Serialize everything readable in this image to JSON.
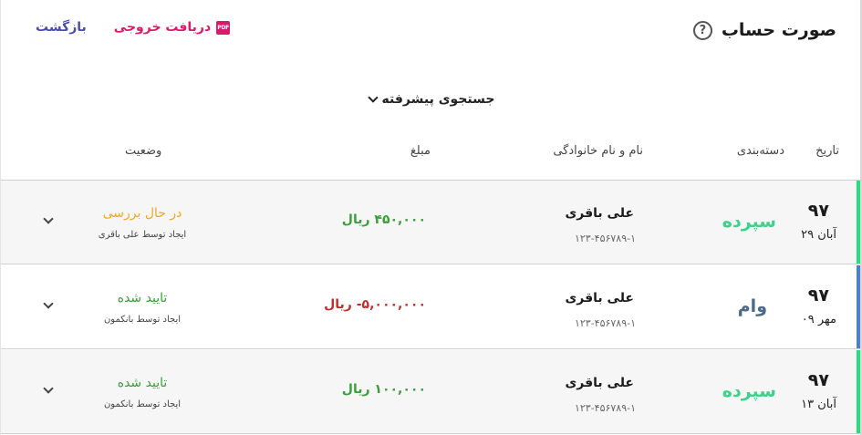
{
  "header": {
    "title": "صورت حساب",
    "help_icon": "?",
    "back_label": "بازگشت",
    "export_label": "دریافت خروجی",
    "export_icon": "PDF"
  },
  "search": {
    "advanced_label": "جستجوی پیشرفته"
  },
  "table": {
    "columns": {
      "date": "تاریخ",
      "category": "دسته‌بندی",
      "name": "نام و نام خانوادگی",
      "amount": "مبلغ",
      "status": "وضعیت"
    },
    "rows": [
      {
        "year": "۹۷",
        "day": "آبان ۲۹",
        "category": "سپرده",
        "name": "علی باقری",
        "account": "۱۲۳-۴۵۶۷۸۹-۱",
        "amount": "۴۵۰,۰۰۰ ریال",
        "status": "در حال بررسی",
        "creator": "ایجاد توسط علی باقری",
        "accent_color": "#22e07a"
      },
      {
        "year": "۹۷",
        "day": "مهر ۰۹",
        "category": "وام",
        "name": "علی باقری",
        "account": "۱۲۳-۴۵۶۷۸۹-۱",
        "amount": "۵,۰۰۰,۰۰۰- ریال",
        "status": "تایید شده",
        "creator": "ایجاد توسط بانکمون",
        "accent_color": "#4a7fd6"
      },
      {
        "year": "۹۷",
        "day": "آبان ۱۳",
        "category": "سپرده",
        "name": "علی باقری",
        "account": "۱۲۳-۴۵۶۷۸۹-۱",
        "amount": "۱۰۰,۰۰۰ ریال",
        "status": "تایید شده",
        "creator": "ایجاد توسط بانکمون",
        "accent_color": "#22e07a"
      }
    ]
  }
}
